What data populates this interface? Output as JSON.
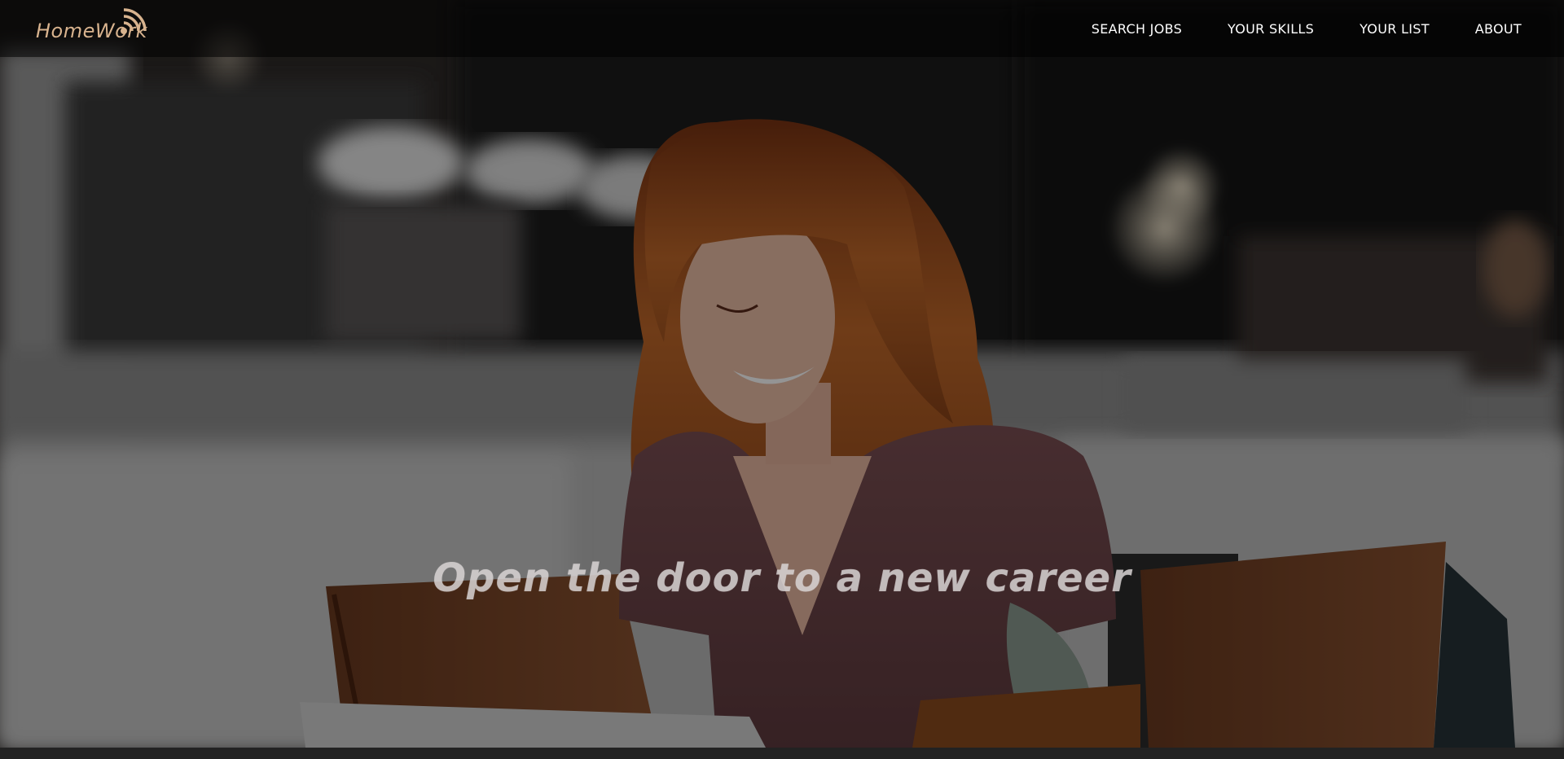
{
  "brand": {
    "logo_text": "HomeWork",
    "logo_color": "#d8b38e"
  },
  "nav": {
    "items": [
      {
        "label": "SEARCH JOBS"
      },
      {
        "label": "YOUR SKILLS"
      },
      {
        "label": "YOUR LIST"
      },
      {
        "label": "ABOUT"
      }
    ]
  },
  "hero": {
    "headline": "Open the door to a new career"
  },
  "colors": {
    "navbar_bg": "#000000",
    "nav_text": "#ffffff",
    "headline_text": "#d7d2d2",
    "footer_strip": "#222222"
  }
}
